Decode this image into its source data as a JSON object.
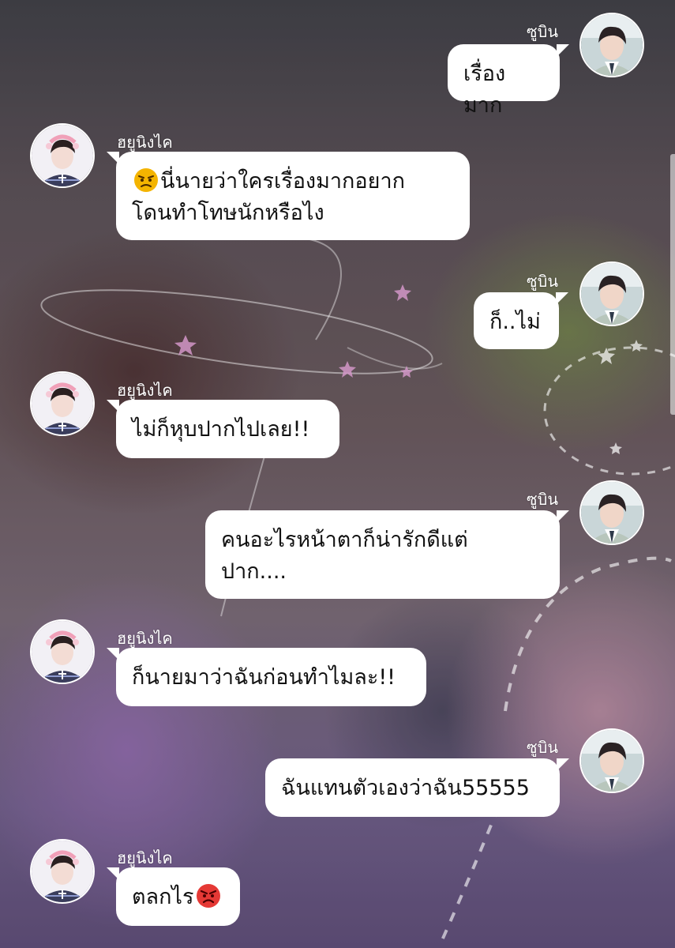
{
  "chat": {
    "participants": {
      "right_name": "ซูบิน",
      "left_name": "ฮยูนิงไค"
    },
    "messages": [
      {
        "side": "right",
        "sender": "ซูบิน",
        "text": "เรื่องมาก"
      },
      {
        "side": "left",
        "sender": "ฮยูนิงไค",
        "emoji": "annoyed-face",
        "line1": "นี่นายว่าใครเรื่องมากอยาก",
        "line2": "โดนทำโทษนักหรือไง"
      },
      {
        "side": "right",
        "sender": "ซูบิน",
        "text": "ก็..ไม่"
      },
      {
        "side": "left",
        "sender": "ฮยูนิงไค",
        "text": "ไม่ก็หุบปากไปเลย!!"
      },
      {
        "side": "right",
        "sender": "ซูบิน",
        "line1": "คนอะไรหน้าตาก็น่ารักดีแต่",
        "line2": "ปาก...."
      },
      {
        "side": "left",
        "sender": "ฮยูนิงไค",
        "text": "ก็นายมาว่าฉันก่อนทำไมละ!!"
      },
      {
        "side": "right",
        "sender": "ซูบิน",
        "text": "ฉันแทนตัวเองว่าฉัน55555"
      },
      {
        "side": "left",
        "sender": "ฮยูนิงไค",
        "text": "ตลกไร",
        "emoji": "angry-face"
      }
    ]
  },
  "colors": {
    "bubble": "#ffffff",
    "name_text": "#ffffff",
    "message_text": "#111111",
    "angry_emoji": "#e53935",
    "annoyed_emoji": "#f4b400"
  }
}
